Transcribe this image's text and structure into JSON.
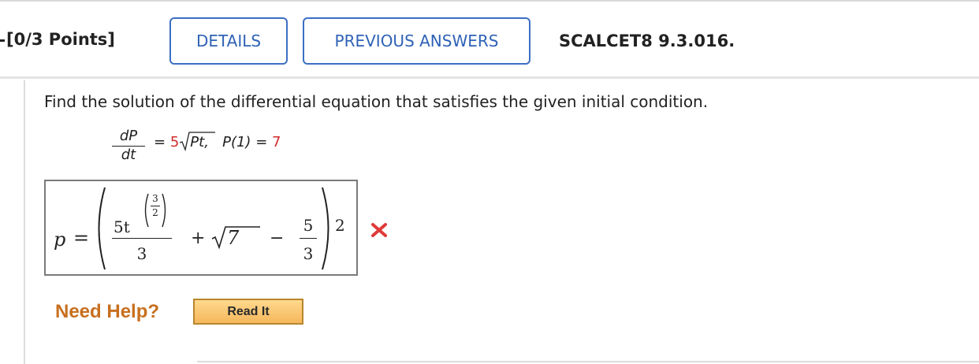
{
  "header": {
    "question_points": "[0/3 Points]",
    "details_label": "DETAILS",
    "previous_answers_label": "PREVIOUS ANSWERS",
    "problem_code": "SCALCET8 9.3.016."
  },
  "question": {
    "prompt": "Find the solution of the differential equation that satisfies the given initial condition.",
    "equation": {
      "lhs_numerator": "dP",
      "lhs_denominator": "dt",
      "equals": "=",
      "coefficient": "5",
      "radicand": "Pt,",
      "condition_lhs": "P(1)",
      "condition_equals": "=",
      "condition_value": "7"
    }
  },
  "answer": {
    "variable": "p",
    "equals": "=",
    "term1_coef": "5t",
    "exp_num": "3",
    "exp_den": "2",
    "term1_den": "3",
    "plus": "+",
    "sqrt_arg": "7",
    "minus": "−",
    "term3_num": "5",
    "term3_den": "3",
    "outer_exponent": "2",
    "status": "incorrect",
    "status_color": "#e03a3a"
  },
  "help": {
    "need_help_label": "Need Help?",
    "read_it_label": "Read It"
  }
}
